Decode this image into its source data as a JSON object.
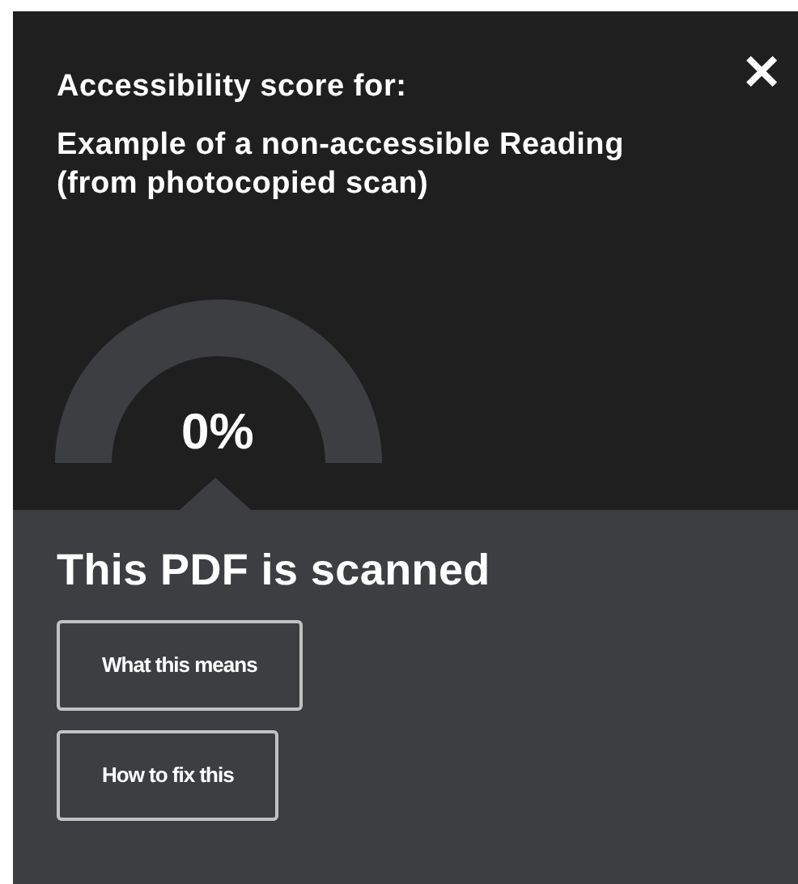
{
  "header": {
    "label": "Accessibility score for:",
    "document_title": "Example of a non-accessible Reading (from photocopied scan)",
    "close": "✕"
  },
  "score": {
    "reading": "0%"
  },
  "status": {
    "heading": "This PDF is scanned",
    "buttons": [
      "What this means",
      "How to fix this"
    ]
  }
}
